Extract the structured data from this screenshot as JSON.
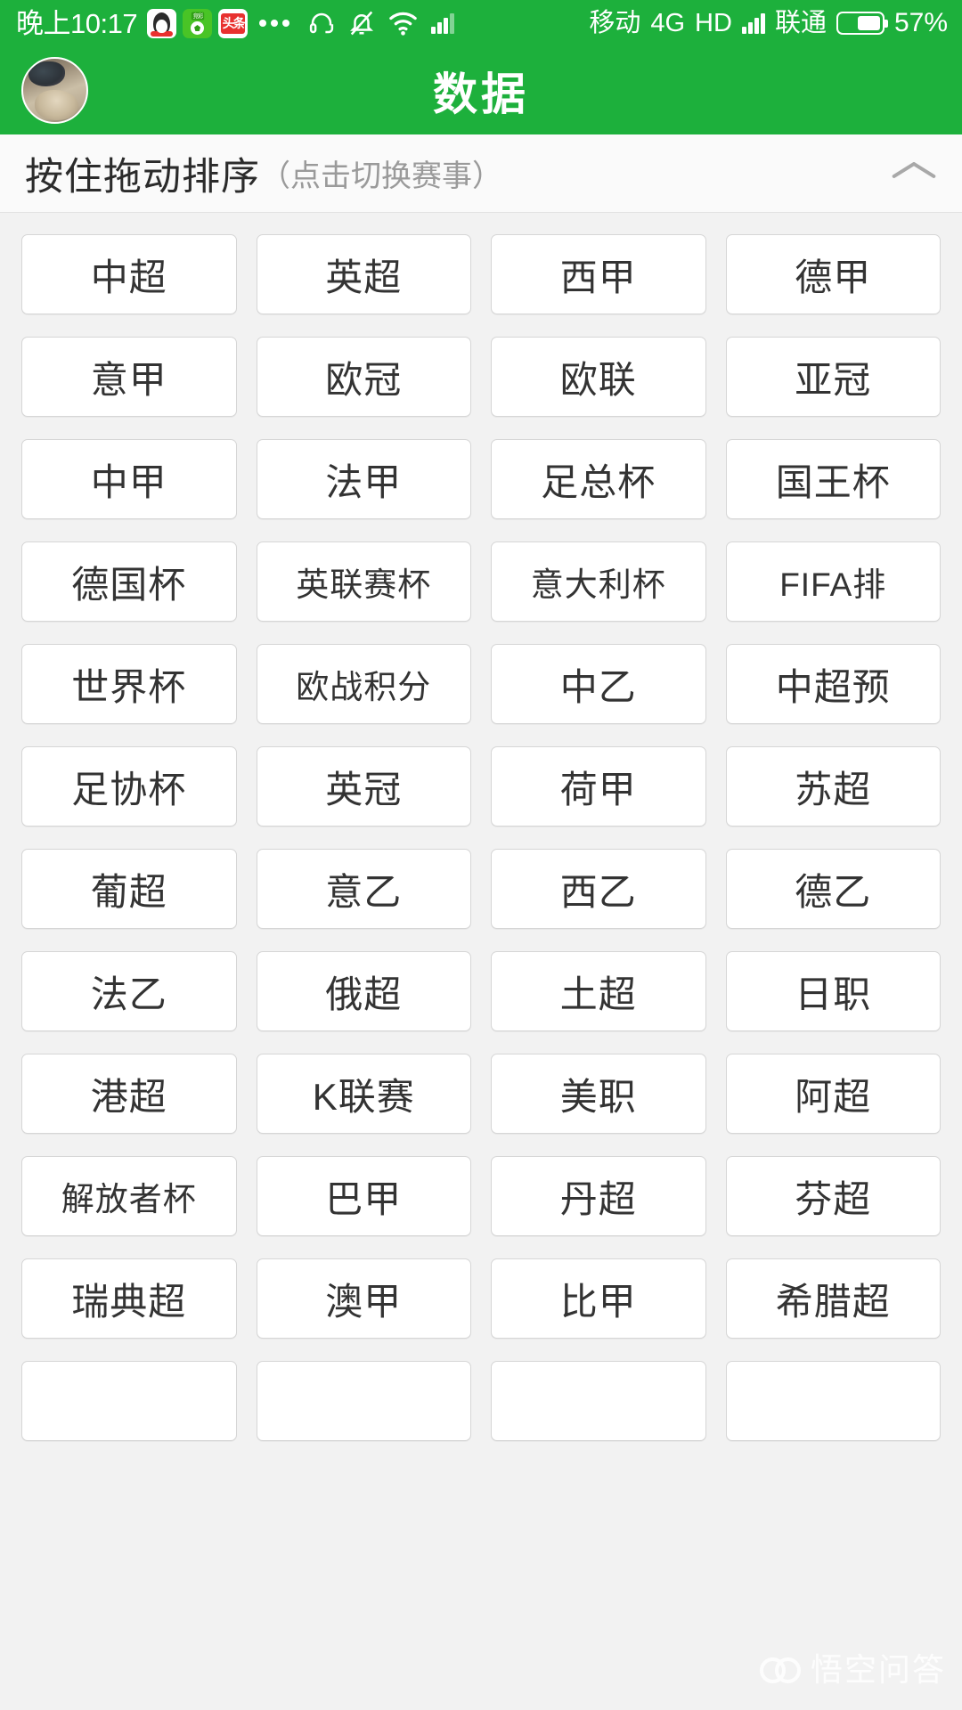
{
  "status_bar": {
    "time": "晚上10:17",
    "app_icons": [
      "qq-icon",
      "football-app-icon",
      "toutiao-icon"
    ],
    "overflow": "…",
    "icons": [
      "headset-icon",
      "bell-muted-icon",
      "wifi-icon",
      "signal-bars-icon"
    ],
    "carrier_primary": "移动",
    "network_type": "4G",
    "hd_label": "HD",
    "carrier_secondary": "联通",
    "battery_percent": "57%",
    "battery_level": 57
  },
  "header": {
    "title": "数据",
    "avatar_name": "user-avatar",
    "accent_color": "#1db03c"
  },
  "sort_header": {
    "main_text": "按住拖动排序",
    "sub_text": "（点击切换赛事）",
    "collapse_icon": "chevron-up-icon"
  },
  "leagues": [
    "中超",
    "英超",
    "西甲",
    "德甲",
    "意甲",
    "欧冠",
    "欧联",
    "亚冠",
    "中甲",
    "法甲",
    "足总杯",
    "国王杯",
    "德国杯",
    "英联赛杯",
    "意大利杯",
    "FIFA排",
    "世界杯",
    "欧战积分",
    "中乙",
    "中超预",
    "足协杯",
    "英冠",
    "荷甲",
    "苏超",
    "葡超",
    "意乙",
    "西乙",
    "德乙",
    "法乙",
    "俄超",
    "土超",
    "日职",
    "港超",
    "K联赛",
    "美职",
    "阿超",
    "解放者杯",
    "巴甲",
    "丹超",
    "芬超",
    "瑞典超",
    "澳甲",
    "比甲",
    "希腊超",
    "",
    "",
    "",
    ""
  ],
  "watermark": {
    "text": "悟空问答",
    "icon": "wukong-mask-icon"
  }
}
